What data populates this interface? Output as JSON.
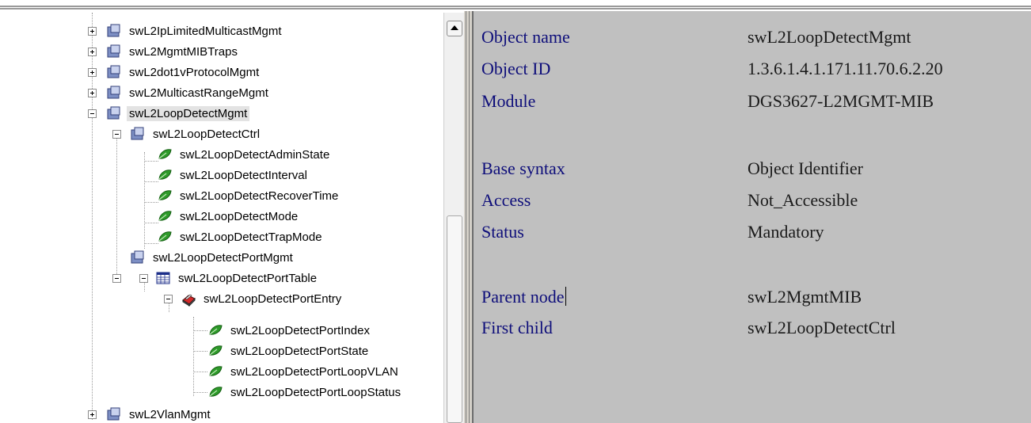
{
  "tree": {
    "items": [
      {
        "label": "swL2IpLimitedMulticastMgmt",
        "icon": "folder-node-icon",
        "expander": "plus"
      },
      {
        "label": "swL2MgmtMIBTraps",
        "icon": "folder-node-icon",
        "expander": "plus"
      },
      {
        "label": "swL2dot1vProtocolMgmt",
        "icon": "folder-node-icon",
        "expander": "plus"
      },
      {
        "label": "swL2MulticastRangeMgmt",
        "icon": "folder-node-icon",
        "expander": "plus"
      },
      {
        "label": "swL2LoopDetectMgmt",
        "icon": "folder-node-icon",
        "expander": "minus",
        "selected": true
      },
      {
        "label": "swL2LoopDetectCtrl",
        "icon": "folder-node-icon",
        "expander": "minus"
      },
      {
        "label": "swL2LoopDetectAdminState",
        "icon": "leaf-icon"
      },
      {
        "label": "swL2LoopDetectInterval",
        "icon": "leaf-icon"
      },
      {
        "label": "swL2LoopDetectRecoverTime",
        "icon": "leaf-icon"
      },
      {
        "label": "swL2LoopDetectMode",
        "icon": "leaf-icon"
      },
      {
        "label": "swL2LoopDetectTrapMode",
        "icon": "leaf-icon"
      },
      {
        "label": "swL2LoopDetectPortMgmt",
        "icon": "folder-node-icon",
        "expander": "minus"
      },
      {
        "label": "swL2LoopDetectPortTable",
        "icon": "table-icon",
        "expander": "minus"
      },
      {
        "label": "swL2LoopDetectPortEntry",
        "icon": "entry-icon",
        "expander": "minus"
      },
      {
        "label": "swL2LoopDetectPortIndex",
        "icon": "leaf-icon"
      },
      {
        "label": "swL2LoopDetectPortState",
        "icon": "leaf-icon"
      },
      {
        "label": "swL2LoopDetectPortLoopVLAN",
        "icon": "leaf-icon"
      },
      {
        "label": "swL2LoopDetectPortLoopStatus",
        "icon": "leaf-icon"
      },
      {
        "label": "swL2VlanMgmt",
        "icon": "folder-node-icon",
        "expander": "plus"
      }
    ]
  },
  "properties": {
    "object_name": {
      "label": "Object name",
      "value": "swL2LoopDetectMgmt"
    },
    "object_id": {
      "label": "Object ID",
      "value": "1.3.6.1.4.1.171.11.70.6.2.20"
    },
    "module": {
      "label": "Module",
      "value": "DGS3627-L2MGMT-MIB"
    },
    "base_syntax": {
      "label": "Base syntax",
      "value": "Object Identifier"
    },
    "access": {
      "label": "Access",
      "value": "Not_Accessible"
    },
    "status": {
      "label": "Status",
      "value": "Mandatory"
    },
    "parent_node": {
      "label": "Parent node",
      "value": "swL2MgmtMIB"
    },
    "first_child": {
      "label": "First child",
      "value": "swL2LoopDetectCtrl"
    }
  },
  "colors": {
    "property_label": "#0e0e7a",
    "pane_background": "#c0c0c0",
    "leaf_green": "#2e9a2a"
  }
}
